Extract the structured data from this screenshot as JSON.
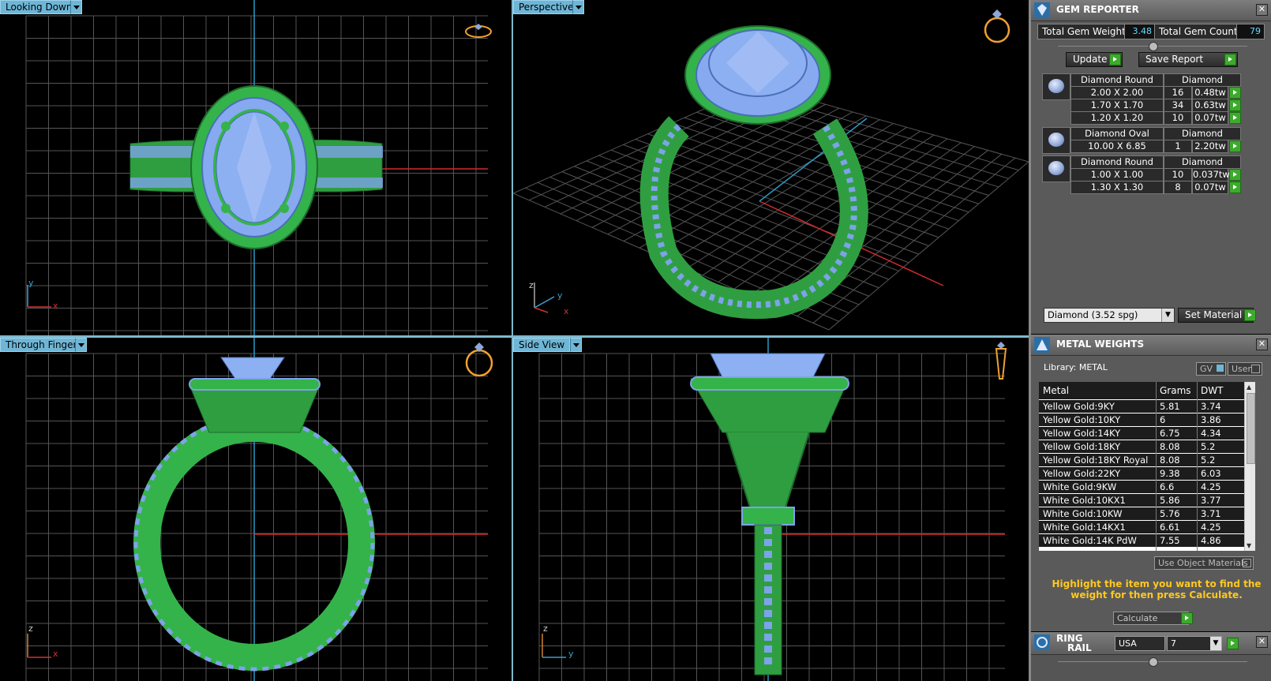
{
  "viewports": {
    "top_left": {
      "label": "Looking Down",
      "axis1": "y",
      "axis2": "x"
    },
    "top_right": {
      "label": "Perspective",
      "axis1": "z",
      "axis2": "y",
      "axis3": "x"
    },
    "bottom_left": {
      "label": "Through Finger",
      "axis1": "z",
      "axis2": "x"
    },
    "bottom_right": {
      "label": "Side View",
      "axis1": "z",
      "axis2": "y"
    }
  },
  "gem_reporter": {
    "title": "GEM REPORTER",
    "total_weight_label": "Total Gem Weight",
    "total_weight_value": "3.48",
    "total_count_label": "Total Gem Count",
    "total_count_value": "79",
    "update_label": "Update",
    "save_report_label": "Save Report",
    "groups": [
      {
        "shape": "Diamond Round",
        "material": "Diamond",
        "rows": [
          {
            "size": "2.00 X 2.00",
            "count": "16",
            "weight": "0.48tw"
          },
          {
            "size": "1.70 X 1.70",
            "count": "34",
            "weight": "0.63tw"
          },
          {
            "size": "1.20 X 1.20",
            "count": "10",
            "weight": "0.07tw"
          }
        ]
      },
      {
        "shape": "Diamond Oval",
        "material": "Diamond",
        "rows": [
          {
            "size": "10.00 X 6.85",
            "count": "1",
            "weight": "2.20tw"
          }
        ]
      },
      {
        "shape": "Diamond Round",
        "material": "Diamond",
        "rows": [
          {
            "size": "1.00 X 1.00",
            "count": "10",
            "weight": "0.037tw"
          },
          {
            "size": "1.30 X 1.30",
            "count": "8",
            "weight": "0.07tw"
          }
        ]
      }
    ],
    "material_select": "Diamond    (3.52 spg)",
    "set_material_label": "Set Material"
  },
  "metal_weights": {
    "title": "METAL WEIGHTS",
    "library_label": "Library: METAL",
    "gv_label": "GV",
    "user_label": "User",
    "columns": [
      "Metal",
      "Grams",
      "DWT"
    ],
    "rows": [
      [
        "Yellow Gold:9KY",
        "5.81",
        "3.74"
      ],
      [
        "Yellow Gold:10KY",
        "6",
        "3.86"
      ],
      [
        "Yellow Gold:14KY",
        "6.75",
        "4.34"
      ],
      [
        "Yellow Gold:18KY",
        "8.08",
        "5.2"
      ],
      [
        "Yellow Gold:18KY Royal",
        "8.08",
        "5.2"
      ],
      [
        "Yellow Gold:22KY",
        "9.38",
        "6.03"
      ],
      [
        "White Gold:9KW",
        "6.6",
        "4.25"
      ],
      [
        "White Gold:10KX1",
        "5.86",
        "3.77"
      ],
      [
        "White Gold:10KW",
        "5.76",
        "3.71"
      ],
      [
        "White Gold:14KX1",
        "6.61",
        "4.25"
      ],
      [
        "White Gold:14K PdW",
        "7.55",
        "4.86"
      ]
    ],
    "use_object_materials": "Use Object Materials",
    "hint": "Highlight the item you want to find the weight for then press Calculate.",
    "calculate_label": "Calculate"
  },
  "ring_rail": {
    "title_line1": "RING",
    "title_line2": "RAIL",
    "region": "USA",
    "size": "7"
  },
  "colors": {
    "metal": "#34b34a",
    "gem": "#7da3e8",
    "grid": "#5a5a5a",
    "accent": "#6fb6d6",
    "hint": "#ffc820"
  }
}
